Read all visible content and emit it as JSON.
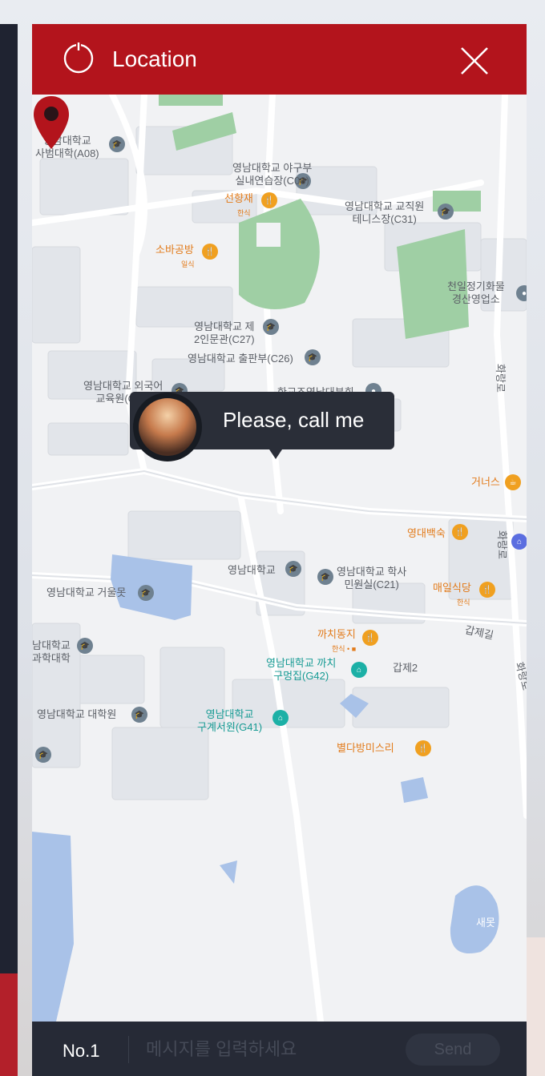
{
  "header": {
    "title": "Location",
    "close_icon": "close-icon",
    "logo_icon": "power-ring-icon",
    "bg_color": "#b3141c"
  },
  "map": {
    "labels": [
      {
        "id": "a08",
        "text": "영남대학교\n사범대학(A08)"
      },
      {
        "id": "c06",
        "text": "영남대학교 야구부\n실내연습장(C06)"
      },
      {
        "id": "seonhyang",
        "text": "선향재"
      },
      {
        "id": "seonhyang_sub",
        "text": "한식"
      },
      {
        "id": "c31",
        "text": "영남대학교 교직원\n테니스장(C31)"
      },
      {
        "id": "sobagongbang",
        "text": "소바공방"
      },
      {
        "id": "sobagongbang_sub",
        "text": "일식"
      },
      {
        "id": "cheonil",
        "text": "천일정기화물\n경산영업소"
      },
      {
        "id": "c27",
        "text": "영남대학교 제\n2인문관(C27)"
      },
      {
        "id": "c26",
        "text": "영남대학교 출판부(C26)"
      },
      {
        "id": "c02",
        "text": "영남대학교 외국어\n교육원(C02)"
      },
      {
        "id": "hangyojo",
        "text": "한교조영남대분회"
      },
      {
        "id": "hwarangro1",
        "text": "화랑로"
      },
      {
        "id": "geoneos",
        "text": "거너스"
      },
      {
        "id": "yeongdae",
        "text": "영대백숙"
      },
      {
        "id": "hwarangro2",
        "text": "화랑로"
      },
      {
        "id": "ynu",
        "text": "영남대학교"
      },
      {
        "id": "c21",
        "text": "영남대학교 학사\n민원실(C21)"
      },
      {
        "id": "maeil",
        "text": "매일식당"
      },
      {
        "id": "maeil_sub",
        "text": "한식"
      },
      {
        "id": "geoul",
        "text": "영남대학교 거울못"
      },
      {
        "id": "gapje",
        "text": "갑제길"
      },
      {
        "id": "kkachidongji",
        "text": "까치동지"
      },
      {
        "id": "kkachidongji_sub",
        "text": "한식 • ■"
      },
      {
        "id": "science",
        "text": "남대학교\n과학대학"
      },
      {
        "id": "g42",
        "text": "영남대학교 까치\n구멍집(G42)"
      },
      {
        "id": "gapje2",
        "text": "갑제2"
      },
      {
        "id": "hwarangro3",
        "text": "화랑로"
      },
      {
        "id": "grad",
        "text": "영남대학교 대학원"
      },
      {
        "id": "g41",
        "text": "영남대학교\n구계서원(G41)"
      },
      {
        "id": "byeolda",
        "text": "별다방미스리"
      },
      {
        "id": "saemot",
        "text": "새못"
      }
    ],
    "bubble": {
      "text": "Please, call me"
    },
    "pin_icon": "map-pin-icon",
    "pin_color": "#b3141c"
  },
  "footer": {
    "name": "No.1",
    "placeholder": "메시지를 입력하세요",
    "send_label": "Send"
  }
}
